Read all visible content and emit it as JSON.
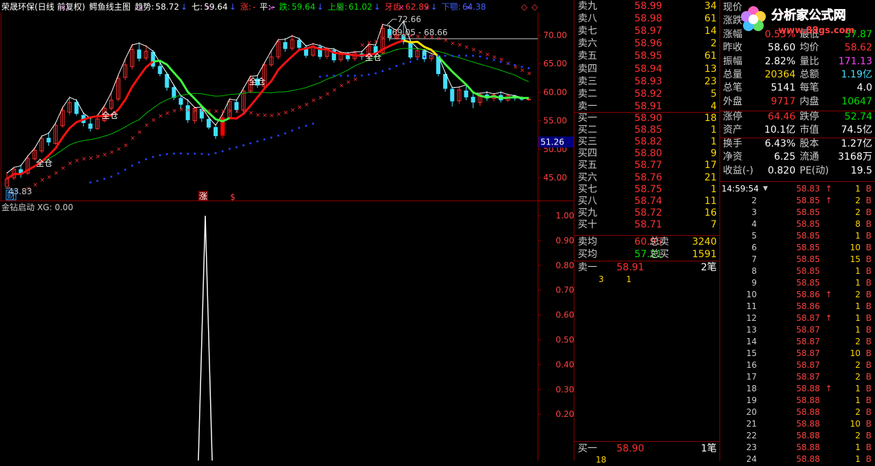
{
  "title": {
    "stock": "荣晟环保(日线 前复权)",
    "indicator": "鳄鱼线主图",
    "trend_label": "趋势:",
    "trend_value": "58.72",
    "seven_label": "七:",
    "seven_value": "59.64",
    "zhang_label": "涨:",
    "zhang_value": "-",
    "ping_label": "平:",
    "ping_value": "-",
    "die_label": "跌:",
    "die_value": "59.64",
    "upper_lip_label": "上唇:",
    "upper_lip_value": "61.02",
    "teeth_label": "牙齿:",
    "teeth_value": "62.89",
    "jaw_label": "下颚:",
    "jaw_value": "64.38"
  },
  "price_axis": [
    "70.00",
    "65.00",
    "60.00",
    "55.00",
    "50.00",
    "45.00"
  ],
  "price_axis_marker": "51.26",
  "annotations": {
    "high": "72.66",
    "range": "69.05 - 68.66",
    "low": "43.83",
    "cai": "财",
    "zhang_mark": "涨",
    "dollar_mark": "$",
    "quancang": [
      "全仓",
      "全仓",
      "全仓",
      "全仓"
    ]
  },
  "sub_chart": {
    "title": "金钻启动 XG: 0.00",
    "axis": [
      "1.00",
      "0.90",
      "0.80",
      "0.70",
      "0.60",
      "0.50",
      "0.40",
      "0.30",
      "0.20"
    ]
  },
  "order_book": {
    "asks": [
      {
        "label": "卖九",
        "price": "58.99",
        "vol": "34"
      },
      {
        "label": "卖八",
        "price": "58.98",
        "vol": "61"
      },
      {
        "label": "卖七",
        "price": "58.97",
        "vol": "14"
      },
      {
        "label": "卖六",
        "price": "58.96",
        "vol": "2"
      },
      {
        "label": "卖五",
        "price": "58.95",
        "vol": "61"
      },
      {
        "label": "卖四",
        "price": "58.94",
        "vol": "13"
      },
      {
        "label": "卖三",
        "price": "58.93",
        "vol": "23"
      },
      {
        "label": "卖二",
        "price": "58.92",
        "vol": "5"
      },
      {
        "label": "卖一",
        "price": "58.91",
        "vol": "4"
      }
    ],
    "bids": [
      {
        "label": "买一",
        "price": "58.90",
        "vol": "18"
      },
      {
        "label": "买二",
        "price": "58.85",
        "vol": "1"
      },
      {
        "label": "买三",
        "price": "58.82",
        "vol": "1"
      },
      {
        "label": "买四",
        "price": "58.80",
        "vol": "9"
      },
      {
        "label": "买五",
        "price": "58.77",
        "vol": "17"
      },
      {
        "label": "买六",
        "price": "58.76",
        "vol": "21"
      },
      {
        "label": "买七",
        "price": "58.75",
        "vol": "1"
      },
      {
        "label": "买八",
        "price": "58.74",
        "vol": "11"
      },
      {
        "label": "买九",
        "price": "58.72",
        "vol": "16"
      },
      {
        "label": "买十",
        "price": "58.71",
        "vol": "7"
      }
    ],
    "ask_avg_label": "卖均",
    "ask_avg": "60.95",
    "total_sell_label": "总卖",
    "total_sell": "3240",
    "bid_avg_label": "买均",
    "bid_avg": "57.21",
    "total_buy_label": "总买",
    "total_buy": "1591",
    "sell1_label": "卖一",
    "sell1_price": "58.91",
    "sell1_count": "2笔",
    "sell1_queue": [
      "3",
      "1"
    ],
    "buy1_label": "买一",
    "buy1_price": "58.90",
    "buy1_count": "1笔",
    "buy1_queue": [
      "18"
    ]
  },
  "stats": [
    {
      "l1": "涨停",
      "v1": "64.46",
      "c1": "red",
      "l2": "跌停",
      "v2": "52.74",
      "c2": "green"
    },
    {
      "l1": "资产",
      "v1": "10.1亿",
      "c1": "white",
      "l2": "市值",
      "v2": "74.5亿",
      "c2": "white"
    },
    {
      "l1": "换手",
      "v1": "6.43%",
      "c1": "white",
      "l2": "股本",
      "v2": "1.27亿",
      "c2": "white"
    },
    {
      "l1": "净资",
      "v1": "6.25",
      "c1": "white",
      "l2": "流通",
      "v2": "3168万",
      "c2": "white"
    },
    {
      "l1": "收益(-)",
      "v1": "0.820",
      "c1": "white",
      "l2": "PE(动)",
      "v2": "19.5",
      "c2": "white"
    }
  ],
  "quote": [
    {
      "l1": "现价",
      "v1": "",
      "c1": "red",
      "l2": "",
      "v2": "",
      "c2": "white"
    },
    {
      "l1": "涨跌",
      "v1": "",
      "c1": "red",
      "l2": "",
      "v2": "",
      "c2": "white"
    },
    {
      "l1": "涨幅",
      "v1": "0.53%",
      "c1": "red",
      "l2": "最低",
      "v2": "57.87",
      "c2": "green"
    },
    {
      "l1": "昨收",
      "v1": "58.60",
      "c1": "white",
      "l2": "均价",
      "v2": "58.62",
      "c2": "red"
    },
    {
      "l1": "振幅",
      "v1": "2.82%",
      "c1": "white",
      "l2": "量比",
      "v2": "171.13",
      "c2": "magenta"
    },
    {
      "l1": "总量",
      "v1": "20364",
      "c1": "yellow",
      "l2": "总额",
      "v2": "1.19亿",
      "c2": "cyan"
    },
    {
      "l1": "总笔",
      "v1": "5141",
      "c1": "white",
      "l2": "每笔",
      "v2": "4.0",
      "c2": "white"
    },
    {
      "l1": "外盘",
      "v1": "9717",
      "c1": "red",
      "l2": "内盘",
      "v2": "10647",
      "c2": "green"
    }
  ],
  "logo": {
    "name": "分析家公式网",
    "url": "www.88gs.com"
  },
  "ticks": {
    "first_time": "14:59:54",
    "rows": [
      {
        "n": "",
        "p": "58.83",
        "arrow": "↑",
        "v": "1",
        "b": "B"
      },
      {
        "n": "2",
        "p": "58.85",
        "arrow": "↑",
        "v": "2",
        "b": "B"
      },
      {
        "n": "3",
        "p": "58.85",
        "arrow": "",
        "v": "2",
        "b": "B"
      },
      {
        "n": "4",
        "p": "58.85",
        "arrow": "",
        "v": "8",
        "b": "B"
      },
      {
        "n": "5",
        "p": "58.85",
        "arrow": "",
        "v": "1",
        "b": "B"
      },
      {
        "n": "6",
        "p": "58.85",
        "arrow": "",
        "v": "10",
        "b": "B"
      },
      {
        "n": "7",
        "p": "58.85",
        "arrow": "",
        "v": "15",
        "b": "B"
      },
      {
        "n": "8",
        "p": "58.85",
        "arrow": "",
        "v": "1",
        "b": "B"
      },
      {
        "n": "9",
        "p": "58.85",
        "arrow": "",
        "v": "1",
        "b": "B"
      },
      {
        "n": "10",
        "p": "58.86",
        "arrow": "↑",
        "v": "2",
        "b": "B"
      },
      {
        "n": "11",
        "p": "58.86",
        "arrow": "",
        "v": "1",
        "b": "B"
      },
      {
        "n": "12",
        "p": "58.87",
        "arrow": "↑",
        "v": "1",
        "b": "B"
      },
      {
        "n": "13",
        "p": "58.87",
        "arrow": "",
        "v": "1",
        "b": "B"
      },
      {
        "n": "14",
        "p": "58.87",
        "arrow": "",
        "v": "2",
        "b": "B"
      },
      {
        "n": "15",
        "p": "58.87",
        "arrow": "",
        "v": "10",
        "b": "B"
      },
      {
        "n": "16",
        "p": "58.87",
        "arrow": "",
        "v": "2",
        "b": "B"
      },
      {
        "n": "17",
        "p": "58.87",
        "arrow": "",
        "v": "2",
        "b": "B"
      },
      {
        "n": "18",
        "p": "58.88",
        "arrow": "↑",
        "v": "1",
        "b": "B"
      },
      {
        "n": "19",
        "p": "58.88",
        "arrow": "",
        "v": "1",
        "b": "B"
      },
      {
        "n": "20",
        "p": "58.88",
        "arrow": "",
        "v": "2",
        "b": "B"
      },
      {
        "n": "21",
        "p": "58.88",
        "arrow": "",
        "v": "10",
        "b": "B"
      },
      {
        "n": "22",
        "p": "58.88",
        "arrow": "",
        "v": "2",
        "b": "B"
      },
      {
        "n": "23",
        "p": "58.88",
        "arrow": "",
        "v": "1",
        "b": "B"
      },
      {
        "n": "24",
        "p": "58.88",
        "arrow": "",
        "v": "1",
        "b": "B"
      }
    ]
  },
  "colors": {
    "up": "#ff3030",
    "down": "#40e0ff",
    "frame": "#8b0000",
    "white": "#ffffff",
    "yellow": "#ffd700"
  }
}
